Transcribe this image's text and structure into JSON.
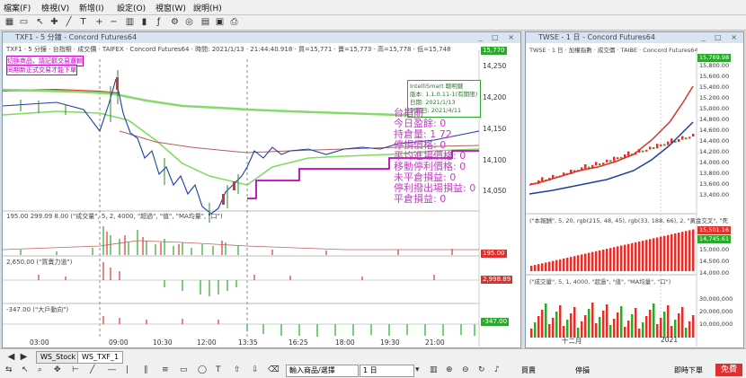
{
  "menu": [
    "檔案(F)",
    "檢視(V)",
    "新增(I)",
    "設定(O)",
    "視窗(W)",
    "說明(H)"
  ],
  "left_window": {
    "title": "TXF1 - 5 分鐘 - Concord Futures64",
    "info_line": "TXF1 · 5 分鐘 · 台指期 · 成交價 · TAIFEX · Concord Futures64 · 時間: 2021/1/13 · 21:44:40.918 · 買=15,771 · 賣=15,773 · 高=15,778 · 低=15,748",
    "warn_line1": "切換商品，請記觀交易邏輯",
    "warn_line2": "同期新正式交易才能下單",
    "box": {
      "line1": "IntelliSmart 聰明鍵",
      "line2": "版本: 1.1.0.11-1(有期限)",
      "line3": "日期: 2021/1/13",
      "line4": "到期日: 2021/4/11"
    },
    "stats": [
      "台指期",
      "今日盈餘: 0",
      "持倉量: 1 72",
      "停損價格: 0",
      "平均進場價格: 0",
      "移動停利價格: 0",
      "未平倉損益: 0",
      "停利撥出場損益: 0",
      "平倉損益: 0"
    ],
    "price_axis": [
      "14,250",
      "14,200",
      "14,150",
      "14,100",
      "14,050"
    ],
    "price_tag": "15,770",
    "vol_info": "195.00  299.09  8.00  (\"成交量\", 5, 2, 4000, \"超過\", \"值\", \"MA均量\", \"口\")",
    "vol_tag": "195.00",
    "p2_info": "2,650.00  (\"買賣力道\")",
    "p2_tag": "2,998.89",
    "p3_info": "-347.00  (\"大戶動向\")",
    "p3_tag": "-347.00",
    "time_axis": [
      "03:00",
      "09:00",
      "10:30",
      "12:00",
      "13:35",
      "16:25",
      "18:00",
      "19:30",
      "21:00"
    ]
  },
  "right_window": {
    "title": "TWSE - 1 日 - Concord Futures64",
    "info_line": "TWSE · 1 日 · 加權指數 · 成交價 · TAIBE · Concord Futures64",
    "price_axis": [
      "15,800.00",
      "15,600.00",
      "15,400.00",
      "15,200.00",
      "15,000.00",
      "14,800.00",
      "14,600.00",
      "14,400.00",
      "14,200.00",
      "14,000.00",
      "13,800.00",
      "13,600.00",
      "13,400.00"
    ],
    "price_tag": "15,769.98",
    "p1_info": "(\"本報酬\", 5, 20, rgb(215, 48, 45), rgb(33, 188, 66), 2, \"黃金交叉\", \"死",
    "p1_axis": [
      "15,501.16",
      "14,745.61",
      "15,000.00",
      "14,500.00",
      "14,000.00"
    ],
    "p2_info": "(\"成交量\", 5, 1, 4000, \"超過\", \"值\", \"MA均量\", \"口\")",
    "p2_axis": [
      "30,000,000",
      "20,000,000",
      "10,000,000"
    ],
    "time_axis": [
      "十二月",
      "2021"
    ]
  },
  "bottom": {
    "tabs": [
      "WS_Stock",
      "WS_TXF_1"
    ],
    "symbol_input": "輸入商品/選擇",
    "period_select": "1 日",
    "buttons": [
      "買賣",
      "停損",
      "即時下單"
    ],
    "badge": "免費"
  },
  "colors": {
    "up": "#e0302d",
    "down": "#21b042",
    "magenta": "#c000c0",
    "green_line": "#7cdc5c"
  }
}
